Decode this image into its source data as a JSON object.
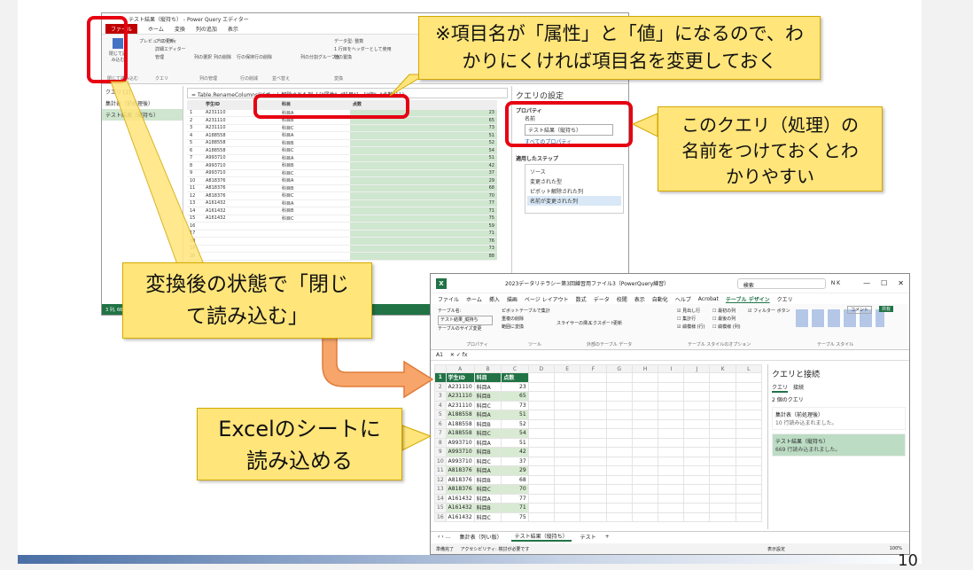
{
  "page_number": "10",
  "pq": {
    "title": "テスト結果（縦持ち） - Power Query エディター",
    "menu": [
      "ファイル",
      "ホーム",
      "変換",
      "列の追加",
      "表示"
    ],
    "ribbon_groups": [
      "閉じて読み込む",
      "クエリ",
      "列の管理",
      "行の削減",
      "並べ替え",
      "変換"
    ],
    "ribbon_items": [
      "プロパティ",
      "詳細エディター",
      "管理",
      "プレビューの更新",
      "列の選択",
      "列の削除",
      "行の保持",
      "行の削除",
      "列の分割",
      "グループ化",
      "データ型: 整数",
      "1 行目をヘッダーとして使用",
      "値の置換"
    ],
    "close_load": "閉じて読み込む",
    "nav_header": "クエリ [2]",
    "queries": [
      "集計表（前処理後）",
      "テスト結果（縦持ち）"
    ],
    "formula": "= Table.RenameColumns(ピボット解除された列,{{\"属性\", \"科目\"}, {\"値\", \"点数\"}})",
    "columns": [
      "学生ID",
      "科目",
      "点数"
    ],
    "rows": [
      [
        "1",
        "A231110",
        "科目A",
        "23"
      ],
      [
        "2",
        "A231110",
        "科目B",
        "65"
      ],
      [
        "3",
        "A231110",
        "科目C",
        "73"
      ],
      [
        "4",
        "A188558",
        "科目A",
        "51"
      ],
      [
        "5",
        "A188558",
        "科目B",
        "52"
      ],
      [
        "6",
        "A188558",
        "科目C",
        "54"
      ],
      [
        "7",
        "A993710",
        "科目A",
        "51"
      ],
      [
        "8",
        "A993710",
        "科目B",
        "42"
      ],
      [
        "9",
        "A993710",
        "科目C",
        "37"
      ],
      [
        "10",
        "A818376",
        "科目A",
        "29"
      ],
      [
        "11",
        "A818376",
        "科目B",
        "68"
      ],
      [
        "12",
        "A818376",
        "科目C",
        "70"
      ],
      [
        "13",
        "A161432",
        "科目A",
        "77"
      ],
      [
        "14",
        "A161432",
        "科目B",
        "71"
      ],
      [
        "15",
        "A161432",
        "科目C",
        "75"
      ],
      [
        "16",
        "",
        "",
        "59"
      ],
      [
        "17",
        "",
        "",
        "71"
      ],
      [
        "18",
        "",
        "",
        "76"
      ],
      [
        "19",
        "",
        "",
        "73"
      ],
      [
        "20",
        "",
        "",
        "88"
      ]
    ],
    "settings_title": "クエリの設定",
    "properties": "プロパティ",
    "name_label": "名前",
    "name_value": "テスト結果（縦持ち）",
    "all_props": "すべてのプロパティ",
    "steps_title": "適用したステップ",
    "steps": [
      "ソース",
      "変更された型",
      "ピボット解除された列",
      "名前が変更された列"
    ],
    "status": "3 列, 669 行"
  },
  "xl": {
    "title": "2023データリテラシー第3回練習用ファイル3（PowerQuery練習）",
    "search": "検索",
    "user": "N K",
    "menu": [
      "ファイル",
      "ホーム",
      "挿入",
      "描画",
      "ページ レイアウト",
      "数式",
      "データ",
      "校閲",
      "表示",
      "自動化",
      "ヘルプ",
      "Acrobat",
      "テーブル デザイン",
      "クエリ"
    ],
    "comment": "コメント",
    "share": "共有",
    "ribbon_groups": [
      "プロパティ",
      "ツール",
      "外部のテーブル データ",
      "テーブル スタイルのオプション",
      "テーブル スタイル"
    ],
    "ribbon_items": [
      "テーブル名:",
      "テスト結果_縦持ち",
      "テーブルのサイズ変更",
      "ピボットテーブルで集計",
      "重複の削除",
      "範囲に変換",
      "スライサーの挿入",
      "エクスポート",
      "更新",
      "見出し行",
      "集計行",
      "縞模様 (行)",
      "最初の列",
      "最後の列",
      "縞模様 (列)",
      "フィルター ボタン"
    ],
    "cell_ref": "A1",
    "col_letters": [
      "A",
      "B",
      "C",
      "D",
      "E",
      "F",
      "G",
      "H",
      "I",
      "J",
      "K",
      "L"
    ],
    "headers": [
      "学生ID",
      "科目",
      "点数"
    ],
    "rows": [
      [
        "A231110",
        "科目A",
        "23"
      ],
      [
        "A231110",
        "科目B",
        "65"
      ],
      [
        "A231110",
        "科目C",
        "73"
      ],
      [
        "A188558",
        "科目A",
        "51"
      ],
      [
        "A188558",
        "科目B",
        "52"
      ],
      [
        "A188558",
        "科目C",
        "54"
      ],
      [
        "A993710",
        "科目A",
        "51"
      ],
      [
        "A993710",
        "科目B",
        "42"
      ],
      [
        "A993710",
        "科目C",
        "37"
      ],
      [
        "A818376",
        "科目A",
        "29"
      ],
      [
        "A818376",
        "科目B",
        "68"
      ],
      [
        "A818376",
        "科目C",
        "70"
      ],
      [
        "A161432",
        "科目A",
        "77"
      ],
      [
        "A161432",
        "科目B",
        "71"
      ],
      [
        "A161432",
        "科目C",
        "75"
      ]
    ],
    "panel_title": "クエリと接続",
    "panel_tabs": [
      "クエリ",
      "接続"
    ],
    "panel_count": "2 個のクエリ",
    "panel_queries": [
      {
        "name": "集計表（前処理後）",
        "info": "10 行読み込まれました。"
      },
      {
        "name": "テスト結果（縦持ち）",
        "info": "669 行読み込まれました。"
      }
    ],
    "sheet_tabs": [
      "集計表（列い版）",
      "テスト結果（縦持ち）",
      "テスト"
    ],
    "status_left": "準備完了",
    "status_acc": "アクセシビリティ: 検討が必要です",
    "status_right": "表示設定",
    "zoom": "100%"
  },
  "callouts": {
    "rename": "※項目名が「属性」と「値」になるので、わかりにくければ項目名を変更しておく",
    "name_query": "このクエリ（処理）の名前をつけておくとわかりやすい",
    "close_load": "変換後の状態で「閉じて読み込む」",
    "excel": "Excelのシートに読み込める"
  }
}
